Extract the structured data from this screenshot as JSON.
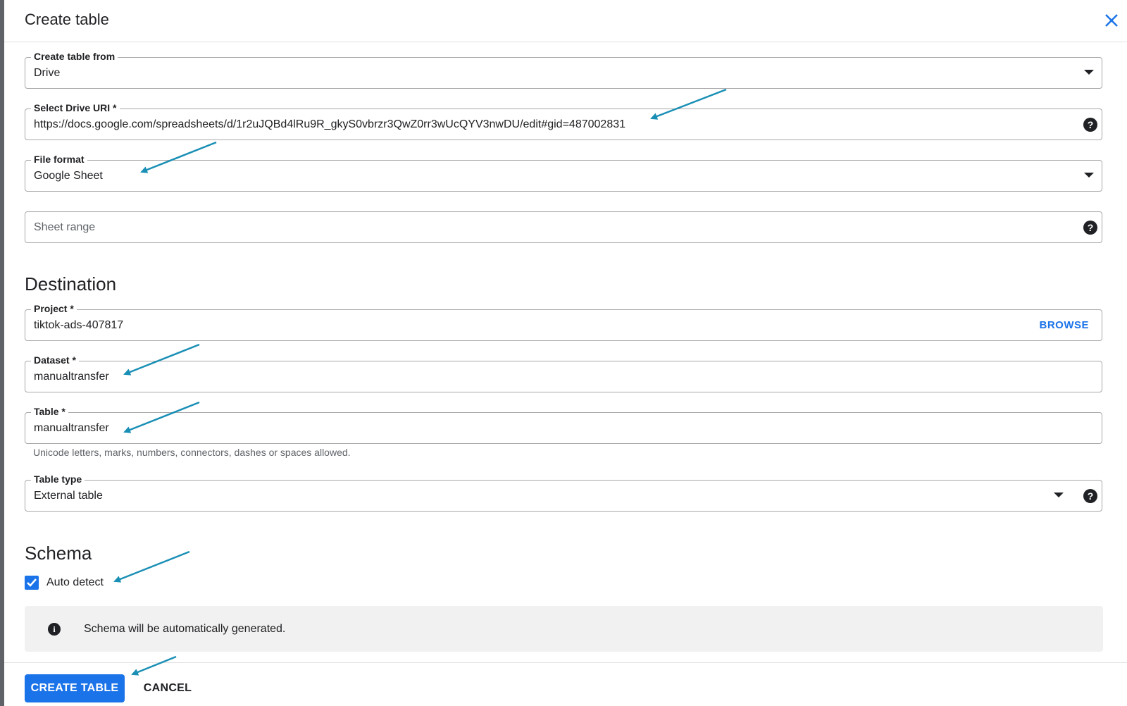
{
  "dialog": {
    "title": "Create table",
    "close_icon": "close-icon"
  },
  "source": {
    "create_from": {
      "label": "Create table from",
      "value": "Drive"
    },
    "drive_uri": {
      "label": "Select Drive URI *",
      "value": "https://docs.google.com/spreadsheets/d/1r2uJQBd4lRu9R_gkyS0vbrzr3QwZ0rr3wUcQYV3nwDU/edit#gid=487002831"
    },
    "file_format": {
      "label": "File format",
      "value": "Google Sheet"
    },
    "sheet_range": {
      "placeholder": "Sheet range"
    }
  },
  "destination": {
    "heading": "Destination",
    "project": {
      "label": "Project *",
      "value": "tiktok-ads-407817",
      "browse_label": "BROWSE"
    },
    "dataset": {
      "label": "Dataset *",
      "value": "manualtransfer"
    },
    "table": {
      "label": "Table *",
      "value": "manualtransfer",
      "hint": "Unicode letters, marks, numbers, connectors, dashes or spaces allowed."
    },
    "table_type": {
      "label": "Table type",
      "value": "External table"
    }
  },
  "schema": {
    "heading": "Schema",
    "auto_detect_label": "Auto detect",
    "auto_detect_checked": true,
    "info_text": "Schema will be automatically generated."
  },
  "footer": {
    "create_label": "CREATE TABLE",
    "cancel_label": "CANCEL"
  },
  "colors": {
    "accent": "#1a73e8",
    "annotation_arrow": "#1a8fb5"
  }
}
